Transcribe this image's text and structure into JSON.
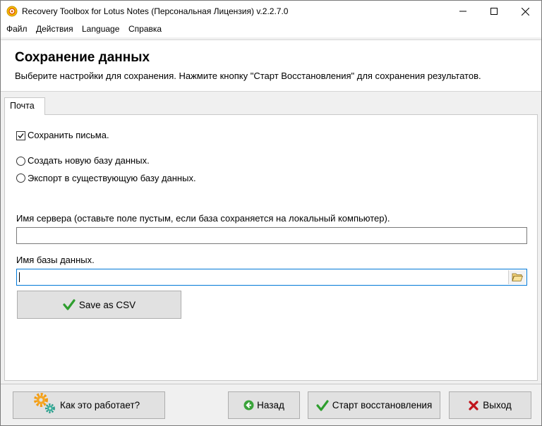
{
  "window": {
    "title": "Recovery Toolbox for Lotus Notes (Персональная Лицензия) v.2.2.7.0"
  },
  "menu": {
    "items": [
      "Файл",
      "Действия",
      "Language",
      "Справка"
    ]
  },
  "header": {
    "title": "Сохранение данных",
    "subtitle": "Выберите настройки для сохранения. Нажмите кнопку \"Старт Восстановления\" для сохранения результатов."
  },
  "tabs": [
    {
      "label": "Почта"
    }
  ],
  "form": {
    "save_messages": {
      "label": "Сохранить письма.",
      "checked": true
    },
    "radio_new_db": {
      "label": "Создать новую базу данных.",
      "selected": false
    },
    "radio_export": {
      "label": "Экспорт в существующую базу данных.",
      "selected": false
    },
    "server_name": {
      "label": "Имя сервера (оставьте поле пустым, если база сохраняется на локальный компьютер).",
      "value": ""
    },
    "db_name": {
      "label": "Имя базы данных.",
      "value": ""
    },
    "save_csv_label": "Save as CSV"
  },
  "footer": {
    "how_it_works": "Как это работает?",
    "back": "Назад",
    "start": "Старт восстановления",
    "exit": "Выход"
  },
  "colors": {
    "accent": "#0078d7",
    "check_green": "#2e9e2e",
    "exit_red": "#c0141b",
    "back_green": "#3aa33a"
  }
}
